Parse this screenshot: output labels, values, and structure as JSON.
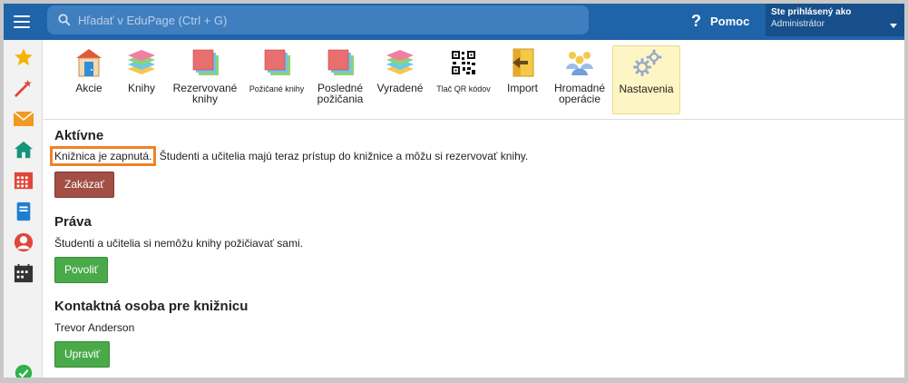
{
  "topbar": {
    "search_placeholder": "Hľadať v EduPage (Ctrl + G)",
    "help_label": "Pomoc",
    "user_line1": "Ste prihlásený ako",
    "user_line2": "Administrátor"
  },
  "sidebar": {
    "items": [
      {
        "icon": "star-icon",
        "color": "#f5b400"
      },
      {
        "icon": "magic-wand-icon",
        "color": "#e0463a"
      },
      {
        "icon": "mail-icon",
        "color": "#f19a1f"
      },
      {
        "icon": "home-icon",
        "color": "#14967a"
      },
      {
        "icon": "calendar-icon",
        "color": "#e0463a"
      },
      {
        "icon": "notebook-icon",
        "color": "#1f7fcf"
      },
      {
        "icon": "user-icon",
        "color": "#e0463a"
      },
      {
        "icon": "schedule-icon",
        "color": "#333333"
      },
      {
        "icon": "check-circle-icon",
        "color": "#2fb24c"
      }
    ]
  },
  "toolbar": {
    "items": [
      {
        "label": "Akcie",
        "icon": "door-icon"
      },
      {
        "label": "Knihy",
        "icon": "books-icon"
      },
      {
        "label": "Rezervované knihy",
        "icon": "stacked-papers-icon"
      },
      {
        "label": "Požičané knihy",
        "icon": "stacked-papers-icon",
        "small": true
      },
      {
        "label": "Posledné požičania",
        "icon": "stacked-papers-icon"
      },
      {
        "label": "Vyradené",
        "icon": "books-icon"
      },
      {
        "label": "Tlač QR kódov",
        "icon": "qr-code-icon",
        "small": true
      },
      {
        "label": "Import",
        "icon": "import-icon"
      },
      {
        "label": "Hromadné operácie",
        "icon": "people-group-icon"
      },
      {
        "label": "Nastavenia",
        "icon": "gears-icon",
        "active": true
      }
    ]
  },
  "main": {
    "active_title": "Aktívne",
    "active_status": "Knižnica je zapnutá.",
    "active_text": "Študenti a učitelia majú teraz prístup do knižnice a môžu si rezervovať knihy.",
    "disable_button": "Zakázať",
    "rights_title": "Práva",
    "rights_text": "Študenti a učitelia si nemôžu knihy požičiavať sami.",
    "allow_button": "Povoliť",
    "contact_title": "Kontaktná osoba pre knižnicu",
    "contact_name": "Trevor Anderson",
    "edit_button": "Upraviť"
  },
  "colors": {
    "topbar": "#1f63a8",
    "highlight": "#f08226",
    "red_button": "#a34f45",
    "green_button": "#4aaa4a",
    "active_tab": "#fdf5c4"
  }
}
